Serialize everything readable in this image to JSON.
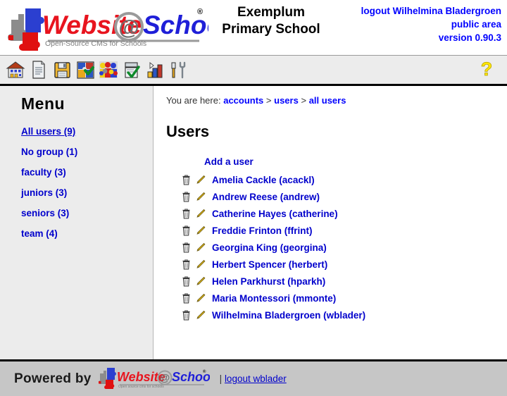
{
  "header": {
    "logo": {
      "name": "website-at-school-logo",
      "word1": "Website",
      "at": "@",
      "word2": "School",
      "tagline": "Open-Source CMS for Schools",
      "registered": "®",
      "colors": {
        "word1": "#e8141e",
        "word2": "#1f1fd8",
        "at_ring": "#9a9a9a",
        "tagline": "#7d7d7d",
        "puzzle_blue": "#2b3fd0",
        "puzzle_gray": "#8c8c8c",
        "puzzle_red": "#e01010"
      }
    },
    "school_name_line1": "Exemplum",
    "school_name_line2": "Primary School",
    "logout_label": "logout Wilhelmina Bladergroen",
    "area_label": "public area",
    "version_label": "version 0.90.3",
    "link_color": "#0000ff"
  },
  "toolbar": {
    "items": [
      {
        "name": "school-icon",
        "title": "school"
      },
      {
        "name": "page-icon",
        "title": "page"
      },
      {
        "name": "save-floppy-icon",
        "title": "save"
      },
      {
        "name": "modules-puzzle-icon",
        "title": "modules"
      },
      {
        "name": "groups-people-icon",
        "title": "groups"
      },
      {
        "name": "checklist-icon",
        "title": "tasks"
      },
      {
        "name": "statistics-bar-chart-icon",
        "title": "statistics"
      },
      {
        "name": "tools-icon",
        "title": "tools"
      }
    ],
    "help": {
      "name": "help-question-icon",
      "title": "help",
      "color": "#ffe600"
    }
  },
  "sidebar": {
    "title": "Menu",
    "items": [
      {
        "label": "All users (9)",
        "active": true
      },
      {
        "label": "No group (1)",
        "active": false
      },
      {
        "label": "faculty (3)",
        "active": false
      },
      {
        "label": "juniors (3)",
        "active": false
      },
      {
        "label": "seniors (3)",
        "active": false
      },
      {
        "label": "team (4)",
        "active": false
      }
    ]
  },
  "breadcrumb": {
    "prefix": "You are here:",
    "items": [
      "accounts",
      "users",
      "all users"
    ],
    "separator": ">"
  },
  "main": {
    "page_title": "Users",
    "add_user_label": "Add a user",
    "row_icons": {
      "delete": "trash-icon",
      "edit": "pencil-icon"
    },
    "users": [
      {
        "label": "Amelia Cackle (acackl)"
      },
      {
        "label": "Andrew Reese (andrew)"
      },
      {
        "label": "Catherine Hayes (catherine)"
      },
      {
        "label": "Freddie Frinton (ffrint)"
      },
      {
        "label": "Georgina King (georgina)"
      },
      {
        "label": "Herbert Spencer (herbert)"
      },
      {
        "label": "Helen Parkhurst (hparkh)"
      },
      {
        "label": "Maria Montessori (mmonte)"
      },
      {
        "label": "Wilhelmina Bladergroen (wblader)"
      }
    ]
  },
  "footer": {
    "powered_by": "Powered by",
    "separator": "|",
    "logout_label": "logout wblader",
    "logo": {
      "word1": "Website",
      "at": "@",
      "word2": "School",
      "tagline": "Open source cms for schools",
      "registered": "®"
    }
  }
}
